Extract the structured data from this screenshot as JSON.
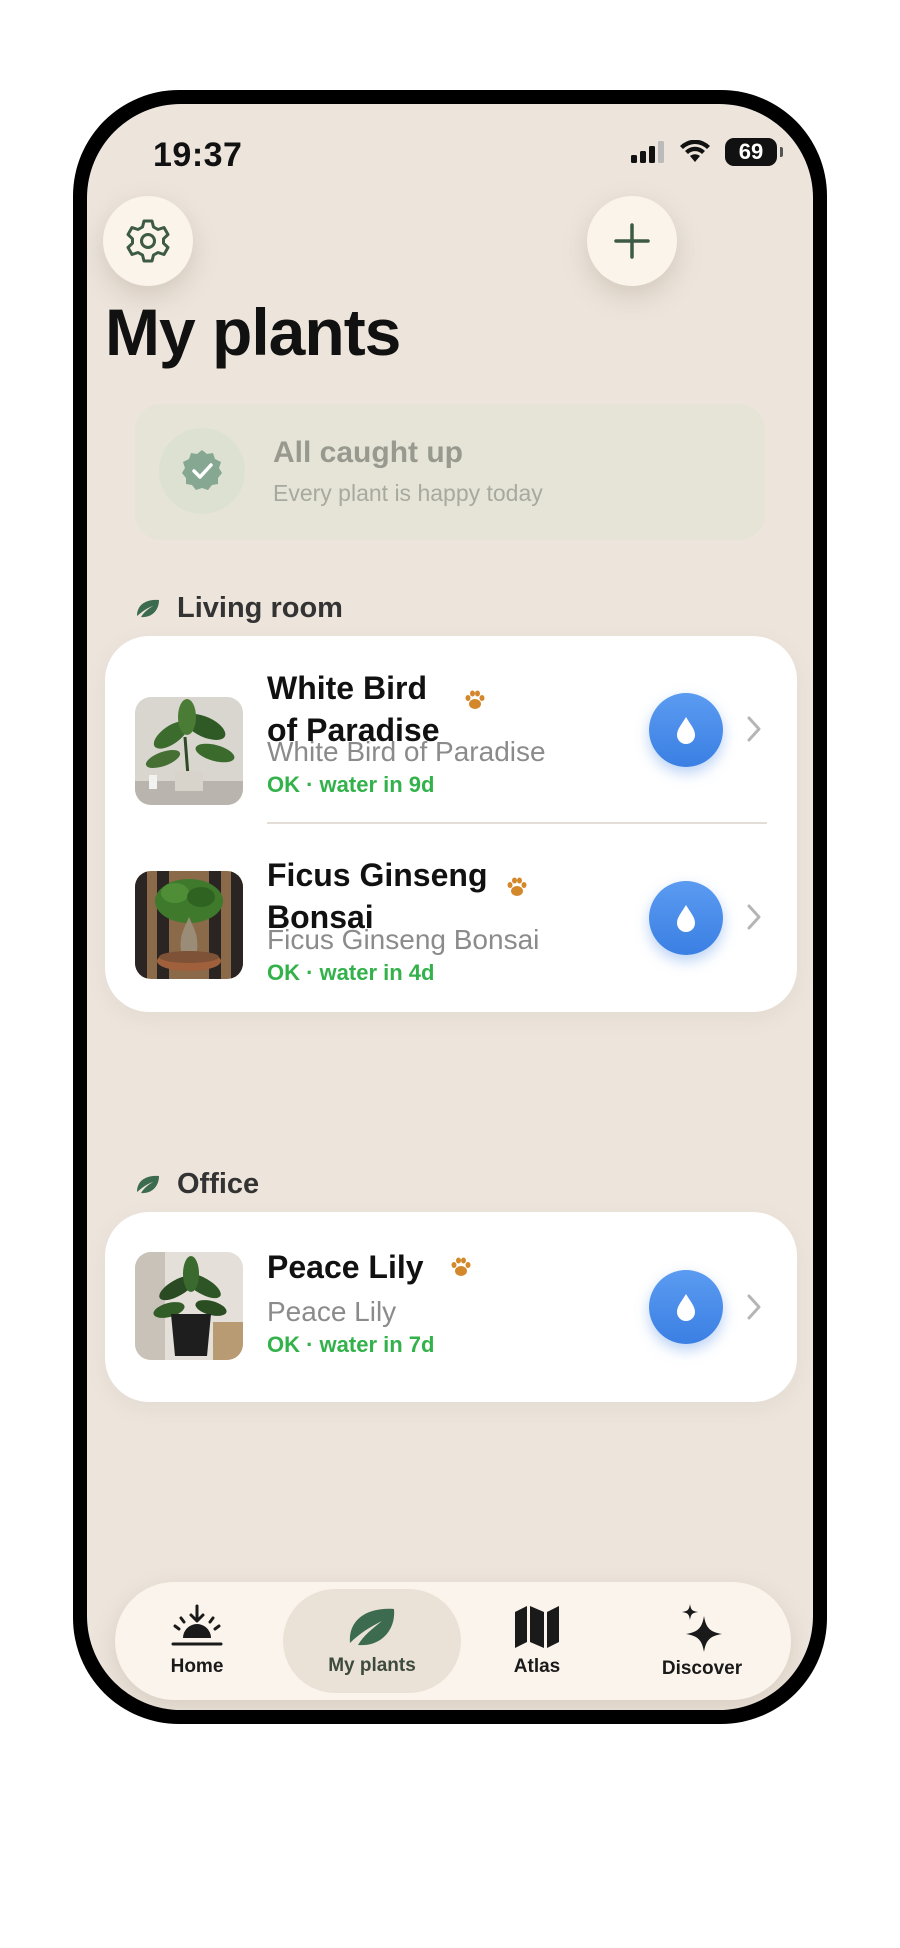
{
  "status": {
    "time": "19:37",
    "battery": "69"
  },
  "header": {
    "title": "My plants"
  },
  "banner": {
    "title": "All caught up",
    "subtitle": "Every plant is happy today"
  },
  "sections": [
    {
      "name": "Living room",
      "plants": [
        {
          "name_line1": "White Bird",
          "name_line2": "of Paradise",
          "species": "White Bird of Paradise",
          "status": "OK · water in 9d"
        },
        {
          "name_line1": "Ficus Ginseng",
          "name_line2": "Bonsai",
          "species": "Ficus Ginseng Bonsai",
          "status": "OK · water in 4d"
        }
      ]
    },
    {
      "name": "Office",
      "plants": [
        {
          "name_line1": "Peace Lily",
          "species": "Peace Lily",
          "status": "OK · water in 7d"
        }
      ]
    }
  ],
  "tabbar": {
    "tabs": [
      {
        "label": "Home",
        "icon": "sunrise-icon"
      },
      {
        "label": "My plants",
        "icon": "leaf-icon",
        "active": true
      },
      {
        "label": "Atlas",
        "icon": "map-icon"
      },
      {
        "label": "Discover",
        "icon": "sparkles-icon"
      }
    ]
  },
  "colors": {
    "accent_green": "#33b24b",
    "water_blue": "#3a7fe3",
    "paw_orange": "#d4882c",
    "leaf_green": "#3d6b4f"
  }
}
